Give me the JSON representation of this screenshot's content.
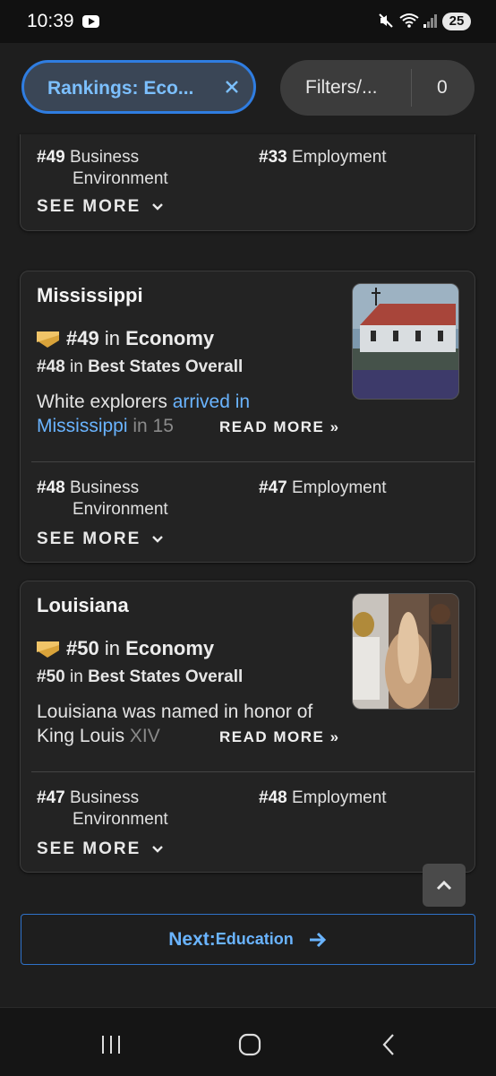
{
  "status_bar": {
    "time": "10:39",
    "battery": "25"
  },
  "chips": {
    "rankings_label": "Rankings: Eco...",
    "filters_label": "Filters/...",
    "filters_count": "0"
  },
  "previous_card": {
    "business_rank": "#49",
    "business_label_1": "Business",
    "business_label_2": "Environment",
    "employment_rank": "#33",
    "employment_label": "Employment",
    "see_more": "SEE MORE"
  },
  "states": [
    {
      "name": "Mississippi",
      "primary_rank": "#49",
      "primary_in": "in",
      "primary_category": "Economy",
      "overall_rank": "#48",
      "overall_in": "in",
      "overall_category": "Best States Overall",
      "blurb_start": "White explorers ",
      "blurb_link": "arrived in Mississippi",
      "blurb_end": " in 15",
      "read_more": "READ MORE »",
      "business_rank": "#48",
      "business_label_1": "Business",
      "business_label_2": "Environment",
      "employment_rank": "#47",
      "employment_label": "Employment",
      "see_more": "SEE MORE"
    },
    {
      "name": "Louisiana",
      "primary_rank": "#50",
      "primary_in": "in",
      "primary_category": "Economy",
      "overall_rank": "#50",
      "overall_in": "in",
      "overall_category": "Best States Overall",
      "blurb_start": "Louisiana was named in honor of King Louis ",
      "blurb_link": "",
      "blurb_end": "XIV",
      "read_more": "READ MORE »",
      "business_rank": "#47",
      "business_label_1": "Business",
      "business_label_2": "Environment",
      "employment_rank": "#48",
      "employment_label": "Employment",
      "see_more": "SEE MORE"
    }
  ],
  "next_button": {
    "prefix": "Next:",
    "label": "Education"
  },
  "icons": {
    "medal": "medal-icon",
    "close": "close-icon",
    "chevron": "chevron-down-icon",
    "scroll_top": "chevron-up-icon",
    "arrow": "arrow-right-icon"
  },
  "colors": {
    "accent": "#6ab4ff",
    "chip_border": "#2f7de1",
    "medal": "#d9a33a"
  }
}
